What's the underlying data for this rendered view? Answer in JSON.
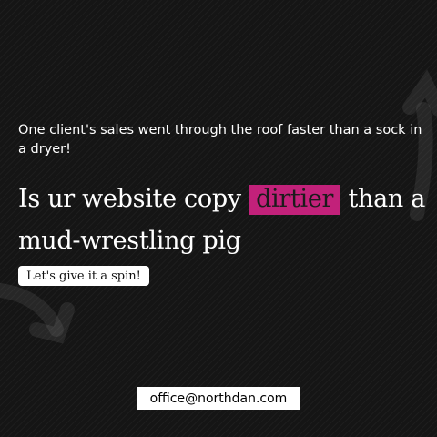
{
  "tagline": "One client's sales went through the roof faster than a sock in a dryer!",
  "headline": {
    "before": "Is ur website copy ",
    "highlight": "dirtier",
    "after": " than a mud-wrestling pig"
  },
  "cta": {
    "label": "Let's give it a spin!"
  },
  "contact": {
    "email": "office@northdan.com"
  },
  "colors": {
    "background": "#151515",
    "highlight": "#c2217a",
    "text": "#ffffff"
  },
  "icons": [
    "curved-arrow-top-right",
    "curved-arrow-left"
  ]
}
